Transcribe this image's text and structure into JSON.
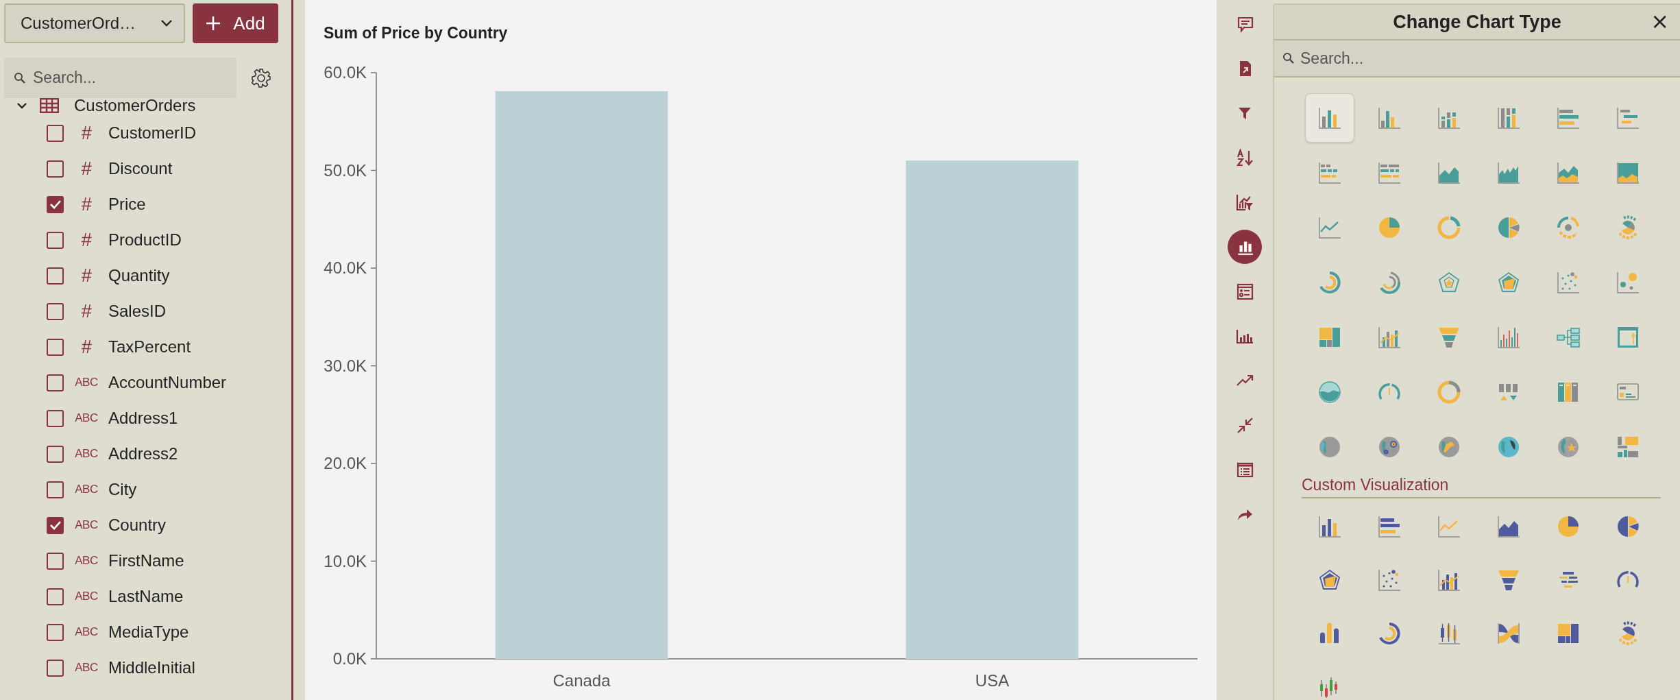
{
  "data_panel": {
    "source_dropdown": {
      "value": "CustomerOrd…"
    },
    "add_button": {
      "label": "Add"
    },
    "search": {
      "placeholder": "Search..."
    },
    "tree": [
      {
        "label": "CustomerOrders",
        "expanded": true,
        "children": [
          {
            "label": "CustomerID",
            "type_label": "#",
            "checked": false
          },
          {
            "label": "Discount",
            "type_label": "#",
            "checked": false
          },
          {
            "label": "Price",
            "type_label": "#",
            "checked": true
          },
          {
            "label": "ProductID",
            "type_label": "#",
            "checked": false
          },
          {
            "label": "Quantity",
            "type_label": "#",
            "checked": false
          },
          {
            "label": "SalesID",
            "type_label": "#",
            "checked": false
          },
          {
            "label": "TaxPercent",
            "type_label": "#",
            "checked": false
          },
          {
            "label": "AccountNumber",
            "type_label": "ABC",
            "checked": false
          },
          {
            "label": "Address1",
            "type_label": "ABC",
            "checked": false
          },
          {
            "label": "Address2",
            "type_label": "ABC",
            "checked": false
          },
          {
            "label": "City",
            "type_label": "ABC",
            "checked": false
          },
          {
            "label": "Country",
            "type_label": "ABC",
            "checked": true
          },
          {
            "label": "FirstName",
            "type_label": "ABC",
            "checked": false
          },
          {
            "label": "LastName",
            "type_label": "ABC",
            "checked": false
          },
          {
            "label": "MediaType",
            "type_label": "ABC",
            "checked": false
          },
          {
            "label": "MiddleInitial",
            "type_label": "ABC",
            "checked": false
          }
        ]
      }
    ]
  },
  "chart": {
    "chart_data": {
      "type": "bar",
      "title": "Sum of Price by Country",
      "categories": [
        "Canada",
        "USA"
      ],
      "values": [
        58100,
        51000
      ],
      "ylim": [
        0,
        60000
      ],
      "yticks": [
        {
          "value": 0,
          "label": "0.0K"
        },
        {
          "value": 10000,
          "label": "10.0K"
        },
        {
          "value": 20000,
          "label": "20.0K"
        },
        {
          "value": 30000,
          "label": "30.0K"
        },
        {
          "value": 40000,
          "label": "40.0K"
        },
        {
          "value": 50000,
          "label": "50.0K"
        },
        {
          "value": 60000,
          "label": "60.0K"
        }
      ]
    }
  },
  "toolbar": [
    {
      "kind": "comment",
      "selected": false
    },
    {
      "kind": "export",
      "selected": false
    },
    {
      "kind": "filter",
      "selected": false
    },
    {
      "kind": "sort",
      "selected": false
    },
    {
      "kind": "chart-filter",
      "selected": false
    },
    {
      "kind": "chart",
      "selected": true
    },
    {
      "kind": "legend",
      "selected": false
    },
    {
      "kind": "columns",
      "selected": false
    },
    {
      "kind": "trend",
      "selected": false
    },
    {
      "kind": "compress",
      "selected": false
    },
    {
      "kind": "list",
      "selected": false
    },
    {
      "kind": "share",
      "selected": false
    }
  ],
  "chart_type_panel": {
    "title": "Change Chart Type",
    "close": "×",
    "search": {
      "placeholder": "Search..."
    },
    "chart_types": [
      {
        "kind": "column-chart",
        "selected": true
      },
      {
        "kind": "grouped-column-chart",
        "selected": false
      },
      {
        "kind": "stacked-column-chart",
        "selected": false
      },
      {
        "kind": "full-stacked-column-chart",
        "selected": false
      },
      {
        "kind": "bar-chart",
        "selected": false
      },
      {
        "kind": "grouped-bar-chart",
        "selected": false
      },
      {
        "kind": "stacked-bar-chart",
        "selected": false
      },
      {
        "kind": "full-stacked-bar-chart",
        "selected": false
      },
      {
        "kind": "area-chart",
        "selected": false
      },
      {
        "kind": "jagged-area-chart",
        "selected": false
      },
      {
        "kind": "stacked-area-chart",
        "selected": false
      },
      {
        "kind": "full-area-chart",
        "selected": false
      },
      {
        "kind": "line-chart",
        "selected": false
      },
      {
        "kind": "pie-chart",
        "selected": false
      },
      {
        "kind": "donut-chart",
        "selected": false
      },
      {
        "kind": "split-pie-chart",
        "selected": false
      },
      {
        "kind": "sunburst-chart",
        "selected": false
      },
      {
        "kind": "ring-sunburst-chart",
        "selected": false
      },
      {
        "kind": "radial-chart",
        "selected": false
      },
      {
        "kind": "multi-radial-chart",
        "selected": false
      },
      {
        "kind": "radar-chart",
        "selected": false
      },
      {
        "kind": "filled-radar-chart",
        "selected": false
      },
      {
        "kind": "scatter-chart",
        "selected": false
      },
      {
        "kind": "bubble-chart",
        "selected": false
      },
      {
        "kind": "treemap-chart",
        "selected": false
      },
      {
        "kind": "combo-chart",
        "selected": false
      },
      {
        "kind": "funnel-chart",
        "selected": false
      },
      {
        "kind": "thin-bar-chart",
        "selected": false
      },
      {
        "kind": "tree-diagram",
        "selected": false
      },
      {
        "kind": "frame-chart",
        "selected": false
      },
      {
        "kind": "liquid-gauge",
        "selected": false
      },
      {
        "kind": "gauge-chart",
        "selected": false
      },
      {
        "kind": "progress-ring",
        "selected": false
      },
      {
        "kind": "number-trend",
        "selected": false
      },
      {
        "kind": "ranking-cards",
        "selected": false
      },
      {
        "kind": "kpi-card",
        "selected": false
      },
      {
        "kind": "globe-map",
        "selected": false
      },
      {
        "kind": "heat-globe-map",
        "selected": false
      },
      {
        "kind": "flow-globe-map",
        "selected": false
      },
      {
        "kind": "filled-globe-map",
        "selected": false
      },
      {
        "kind": "pin-globe-map",
        "selected": false
      },
      {
        "kind": "grid-map",
        "selected": false
      }
    ],
    "custom_section": {
      "title": "Custom Visualization",
      "chart_types": [
        {
          "kind": "column-chart",
          "selected": false
        },
        {
          "kind": "bar-chart",
          "selected": false
        },
        {
          "kind": "line-chart",
          "selected": false
        },
        {
          "kind": "area-chart",
          "selected": false
        },
        {
          "kind": "pie-chart",
          "selected": false
        },
        {
          "kind": "split-pie-chart",
          "selected": false
        },
        {
          "kind": "filled-radar-chart",
          "selected": false
        },
        {
          "kind": "scatter-chart",
          "selected": false
        },
        {
          "kind": "combo-chart",
          "selected": false
        },
        {
          "kind": "funnel-chart",
          "selected": false
        },
        {
          "kind": "word-cloud",
          "selected": false
        },
        {
          "kind": "gauge-chart",
          "selected": false
        },
        {
          "kind": "cylinder-chart",
          "selected": false
        },
        {
          "kind": "radial-chart",
          "selected": false
        },
        {
          "kind": "box-plot",
          "selected": false
        },
        {
          "kind": "sankey-chart",
          "selected": false
        },
        {
          "kind": "treemap-chart",
          "selected": false
        },
        {
          "kind": "ring-sunburst-chart",
          "selected": false
        },
        {
          "kind": "candlestick-chart",
          "selected": false
        }
      ]
    }
  }
}
